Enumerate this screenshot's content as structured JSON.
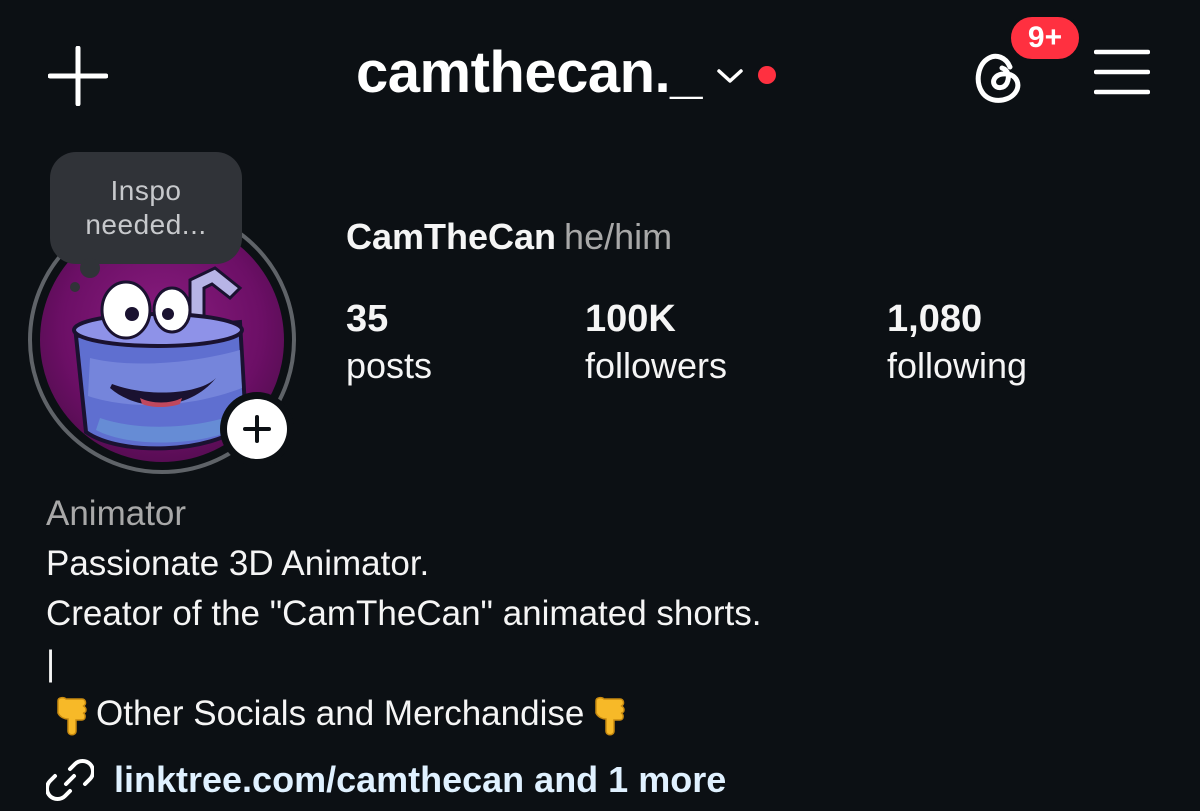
{
  "header": {
    "username": "camthecan._",
    "notification_badge": "9+",
    "accent_red": "#ff3040",
    "icons": [
      "plus-icon",
      "chevron-down-icon",
      "threads-icon",
      "hamburger-menu-icon"
    ]
  },
  "note": {
    "line1": "Inspo",
    "line2": "needed..."
  },
  "profile": {
    "display_name": "CamTheCan",
    "pronouns": "he/him",
    "stats": [
      {
        "value": "35",
        "label": "posts"
      },
      {
        "value": "100K",
        "label": "followers"
      },
      {
        "value": "1,080",
        "label": "following"
      }
    ]
  },
  "bio": {
    "category": "Animator",
    "line1": "Passionate 3D Animator.",
    "line2": "Creator of the \"CamTheCan\" animated shorts.",
    "line3": "|",
    "line4": "Other Socials and Merchandise"
  },
  "link": {
    "text": "linktree.com/camthecan and 1 more",
    "icon": "link-icon"
  },
  "colors": {
    "background": "#0c1014",
    "text": "#f5f5f5",
    "secondary_text": "#a8a8a8",
    "link_text": "#e0f1ff"
  }
}
